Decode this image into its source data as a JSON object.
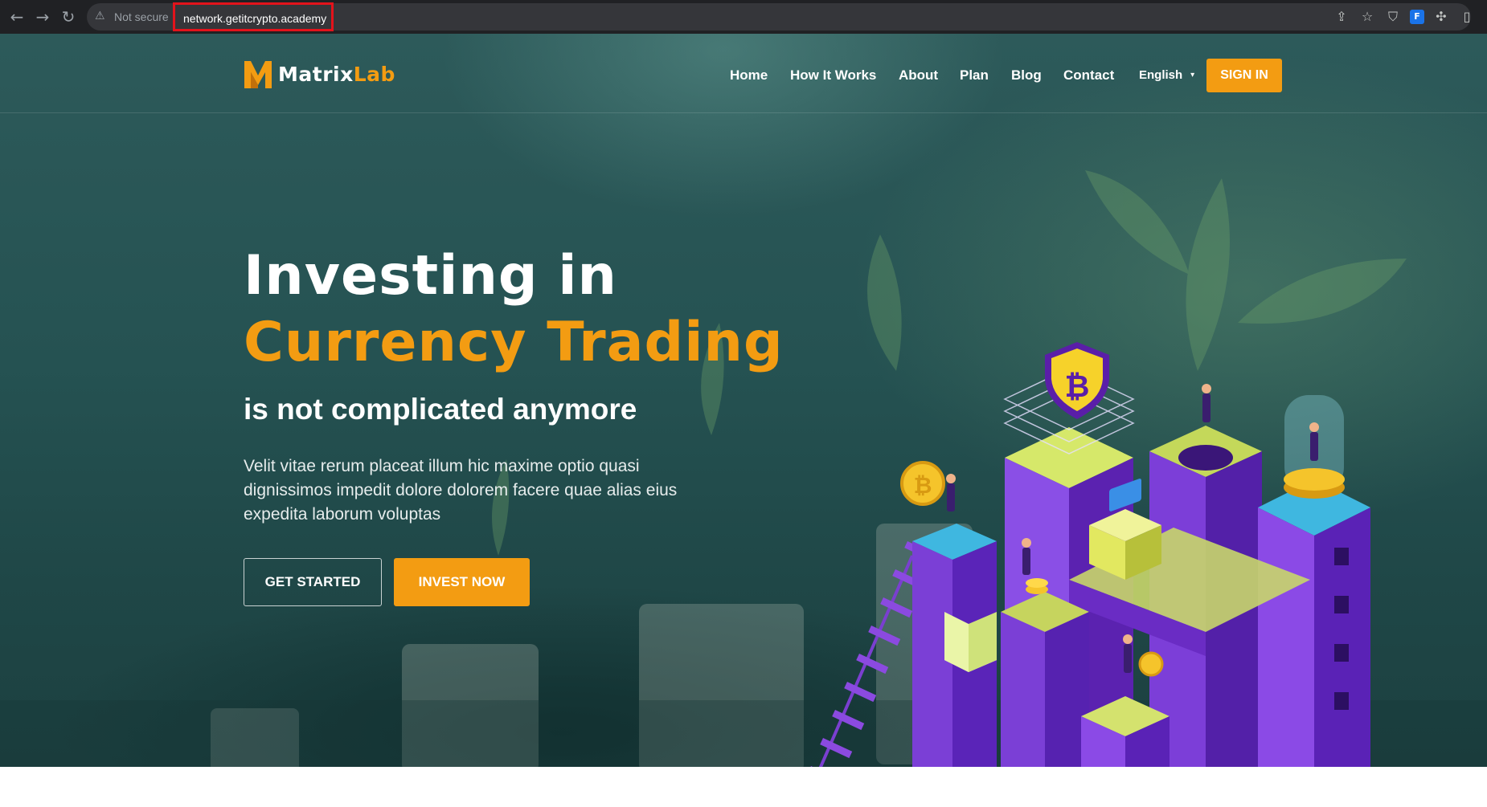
{
  "browser": {
    "back_icon": "arrow-left-icon",
    "forward_icon": "arrow-right-icon",
    "reload_icon": "reload-icon",
    "security_label": "Not secure",
    "url": "network.getitcrypto.academy",
    "url_highlight_color": "#e3131b"
  },
  "site": {
    "logo_word_1": "Matrix",
    "logo_word_2": "Lab",
    "accent_color": "#f39c12"
  },
  "nav": {
    "items": [
      {
        "label": "Home"
      },
      {
        "label": "How It Works"
      },
      {
        "label": "About"
      },
      {
        "label": "Plan"
      },
      {
        "label": "Blog"
      },
      {
        "label": "Contact"
      }
    ],
    "language": "English",
    "signin_label": "SIGN IN"
  },
  "hero": {
    "title_line1": "Investing in",
    "title_line2": "Currency Trading",
    "subtitle": "is not complicated anymore",
    "description": "Velit vitae rerum placeat illum hic maxime optio quasi dignissimos impedit dolore dolorem facere quae alias eius expedita laborum voluptas",
    "cta_primary": "GET STARTED",
    "cta_secondary": "INVEST NOW",
    "illustration": "isometric-crypto-city-illustration"
  }
}
